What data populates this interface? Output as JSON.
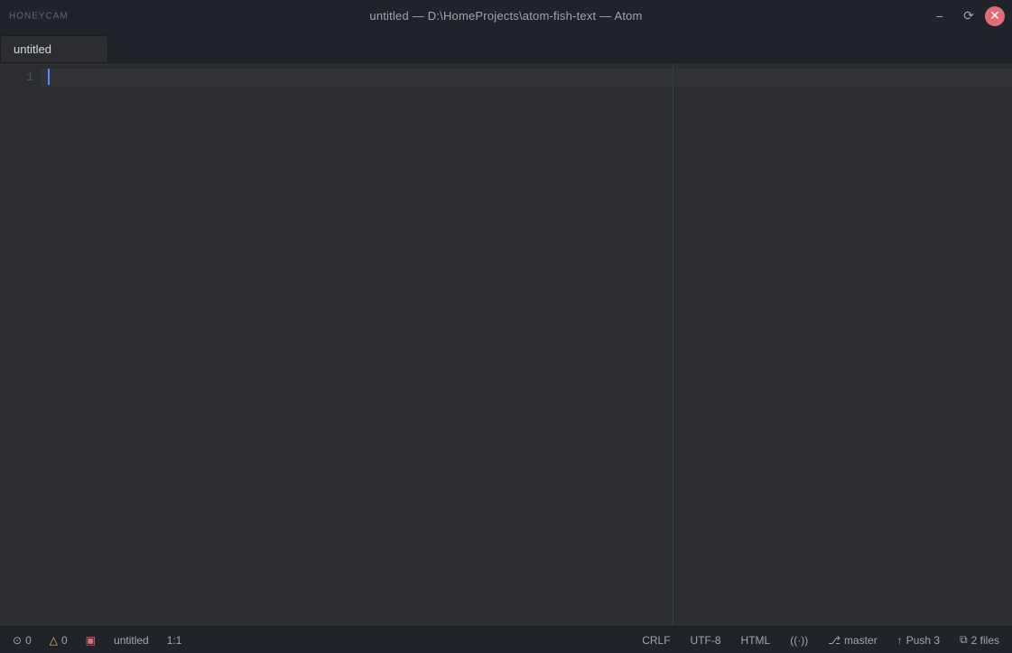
{
  "titlebar": {
    "title": "untitled — D:\\HomeProjects\\atom-fish-text — Atom",
    "logo": "HONEYCAM",
    "minimize_label": "−",
    "restore_label": "⟳",
    "close_label": "✕"
  },
  "tabs": [
    {
      "label": "untitled",
      "active": true
    }
  ],
  "editor": {
    "line_numbers": [
      "1"
    ],
    "content": ""
  },
  "statusbar": {
    "errors_count": "0",
    "warnings_count": "0",
    "file_name": "untitled",
    "cursor_position": "1:1",
    "line_ending": "CRLF",
    "encoding": "UTF-8",
    "grammar": "HTML",
    "git_icon": "⊕",
    "branch": "master",
    "push_label": "Push 3",
    "files_label": "2 files"
  }
}
